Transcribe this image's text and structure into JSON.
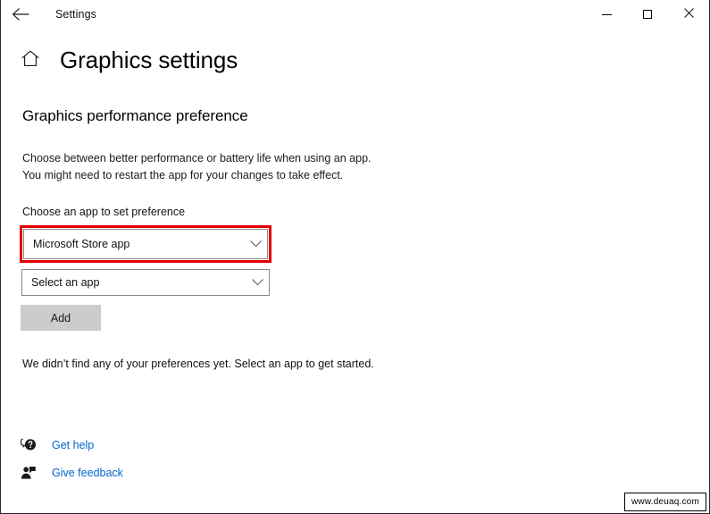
{
  "window": {
    "title": "Settings",
    "back_icon": "arrow-left-icon",
    "controls": {
      "minimize": "minimize-icon",
      "maximize": "maximize-icon",
      "close": "close-icon"
    }
  },
  "header": {
    "home_icon": "home-icon",
    "page_title": "Graphics settings"
  },
  "main": {
    "section_title": "Graphics performance preference",
    "description_line1": "Choose between better performance or battery life when using an app.",
    "description_line2": "You might need to restart the app for your changes to take effect.",
    "field_label": "Choose an app to set preference",
    "app_type_combo": {
      "value": "Microsoft Store app",
      "chevron_icon": "chevron-down-icon",
      "highlighted": true,
      "highlight_color": "#e00000"
    },
    "select_app_combo": {
      "value": "Select an app",
      "chevron_icon": "chevron-down-icon"
    },
    "add_button_label": "Add",
    "add_button_color": "#cccccc",
    "empty_state": "We didn’t find any of your preferences yet. Select an app to get started."
  },
  "footer": {
    "link_color": "#0066cc",
    "links": [
      {
        "label": "Get help",
        "icon": "help-bubble-icon"
      },
      {
        "label": "Give feedback",
        "icon": "feedback-person-icon"
      }
    ]
  },
  "watermark": {
    "text": "www.deuaq.com"
  }
}
